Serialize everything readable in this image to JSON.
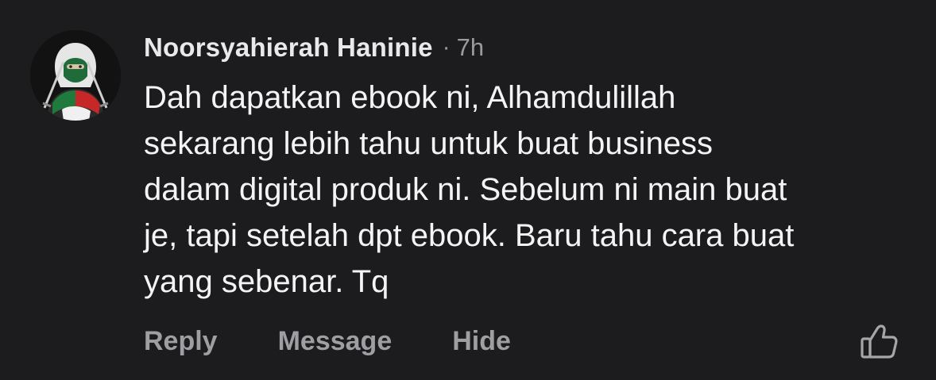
{
  "comment": {
    "author": "Noorsyahierah Haninie",
    "separator": "·",
    "time": "7h",
    "text": "Dah dapatkan ebook ni, Alhamdulillah\nsekarang lebih tahu untuk buat business\ndalam digital produk ni. Sebelum ni main buat\nje, tapi setelah dpt ebook. Baru tahu cara buat\nyang sebenar. Tq",
    "actions": {
      "reply": "Reply",
      "message": "Message",
      "hide": "Hide"
    },
    "icons": {
      "like": "thumbs-up-icon"
    }
  },
  "colors": {
    "background": "#1c1c1e",
    "primary_text": "#f4f4f5",
    "secondary_text": "#9e9ea3"
  }
}
